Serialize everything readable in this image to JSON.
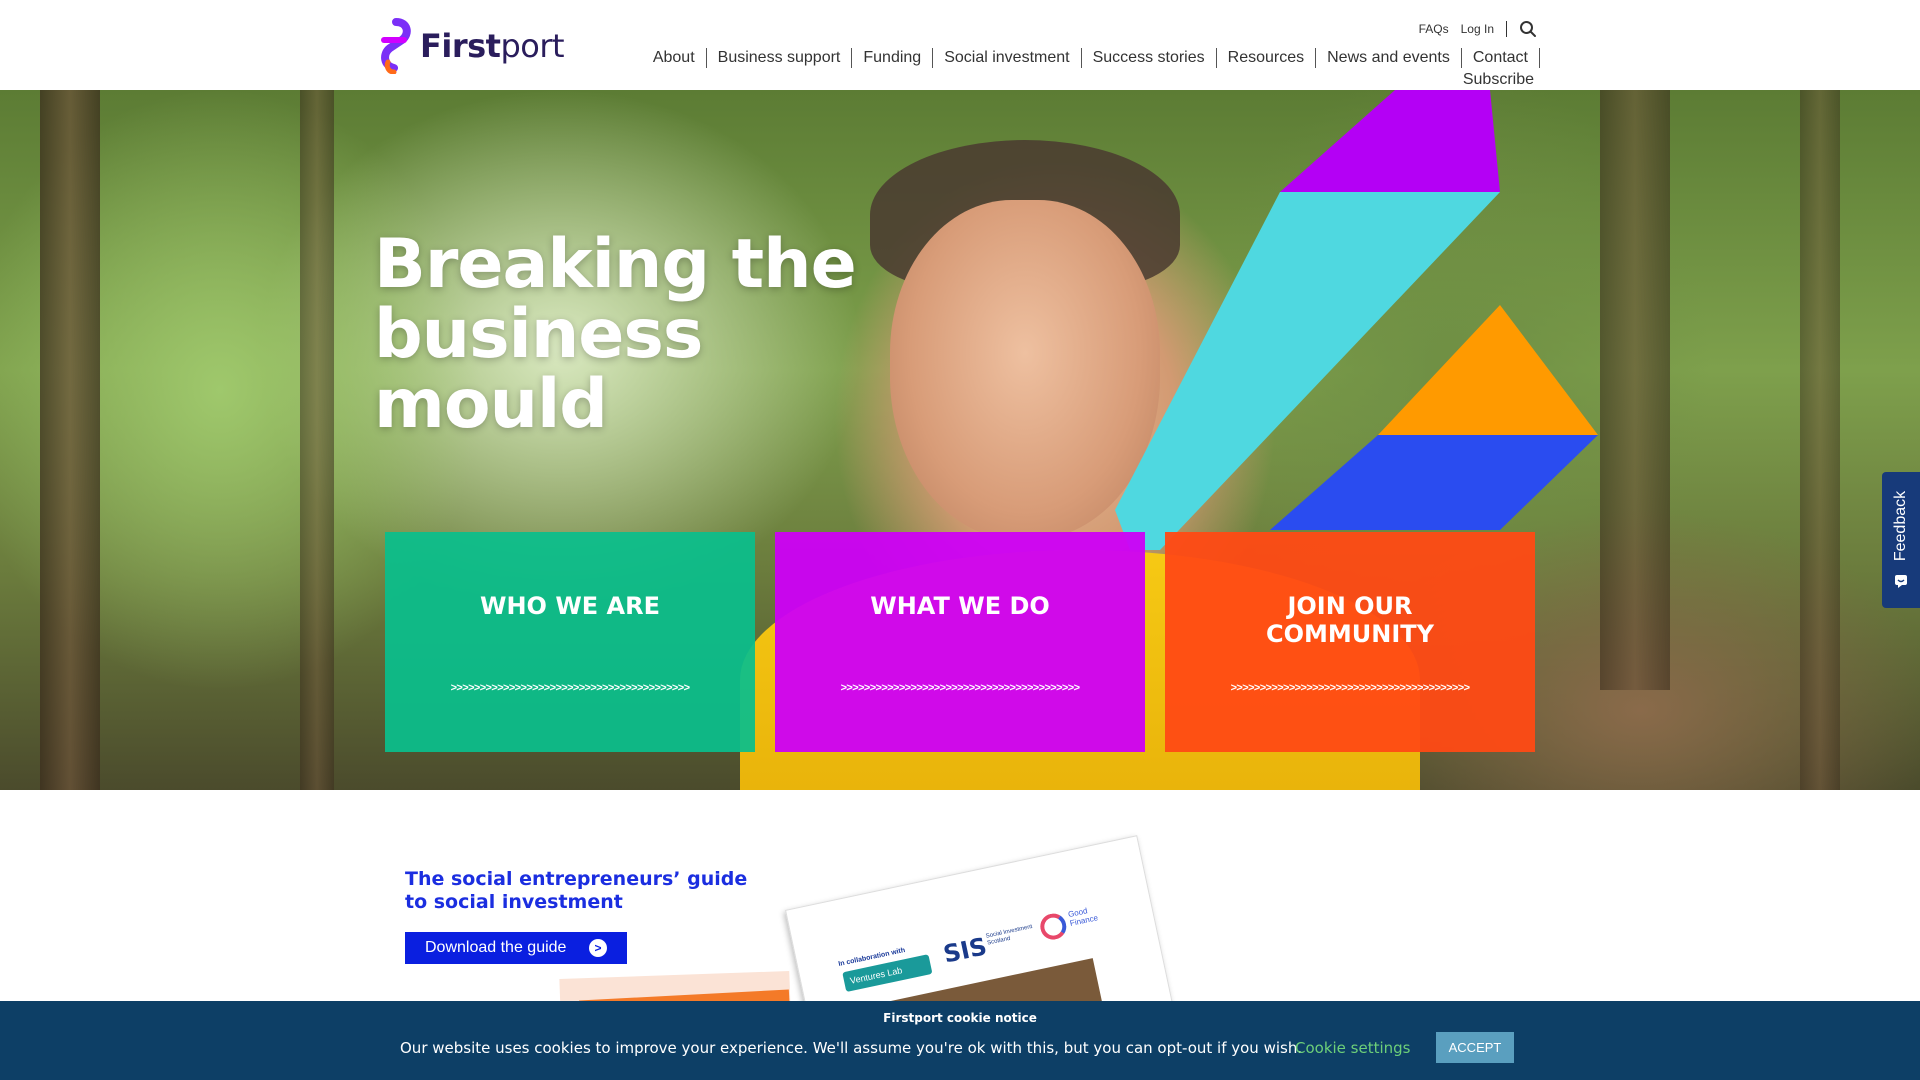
{
  "brand": {
    "logo_main": "First",
    "logo_light": "port",
    "colors": {
      "purple": "#7b2ff7",
      "magenta": "#d100ff",
      "teal": "#0abe8c",
      "orange": "#ff4a14",
      "navy": "#0d3f66",
      "blue": "#0a1fe0"
    }
  },
  "utility_nav": {
    "faqs": "FAQs",
    "login": "Log In",
    "search_icon": "search-icon"
  },
  "main_nav": {
    "items": [
      "About",
      "Business support",
      "Funding",
      "Social investment",
      "Success stories",
      "Resources",
      "News and events",
      "Contact"
    ],
    "subscribe": "Subscribe"
  },
  "hero": {
    "title": "Breaking the business mould",
    "cards": [
      {
        "title": "WHO WE ARE",
        "arrows": ">>>>>>>>>>>>>>>>>>>>>>>>>>>>>>>>>>>>>>>>>"
      },
      {
        "title": "WHAT WE DO",
        "arrows": ">>>>>>>>>>>>>>>>>>>>>>>>>>>>>>>>>>>>>>>>>"
      },
      {
        "title": "JOIN OUR COMMUNITY",
        "arrows": ">>>>>>>>>>>>>>>>>>>>>>>>>>>>>>>>>>>>>>>>>"
      }
    ]
  },
  "feedback": {
    "label": "Feedback"
  },
  "guide": {
    "title": "The social entrepreneurs’ guide to social investment",
    "button_label": "Download the guide",
    "button_icon": ">",
    "brochure": {
      "collab_text": "In collaboration with",
      "ventures_lab": "Ventures Lab",
      "sis": "SIS",
      "sis_sub": "Social Investment Scotland",
      "good_finance": "Good Finance"
    }
  },
  "cookie": {
    "title": "Firstport cookie notice",
    "text": "Our website uses cookies to improve your experience. We'll assume you're ok with this, but you can opt-out if you wish.",
    "settings_label": "Cookie settings",
    "accept_label": "ACCEPT"
  }
}
